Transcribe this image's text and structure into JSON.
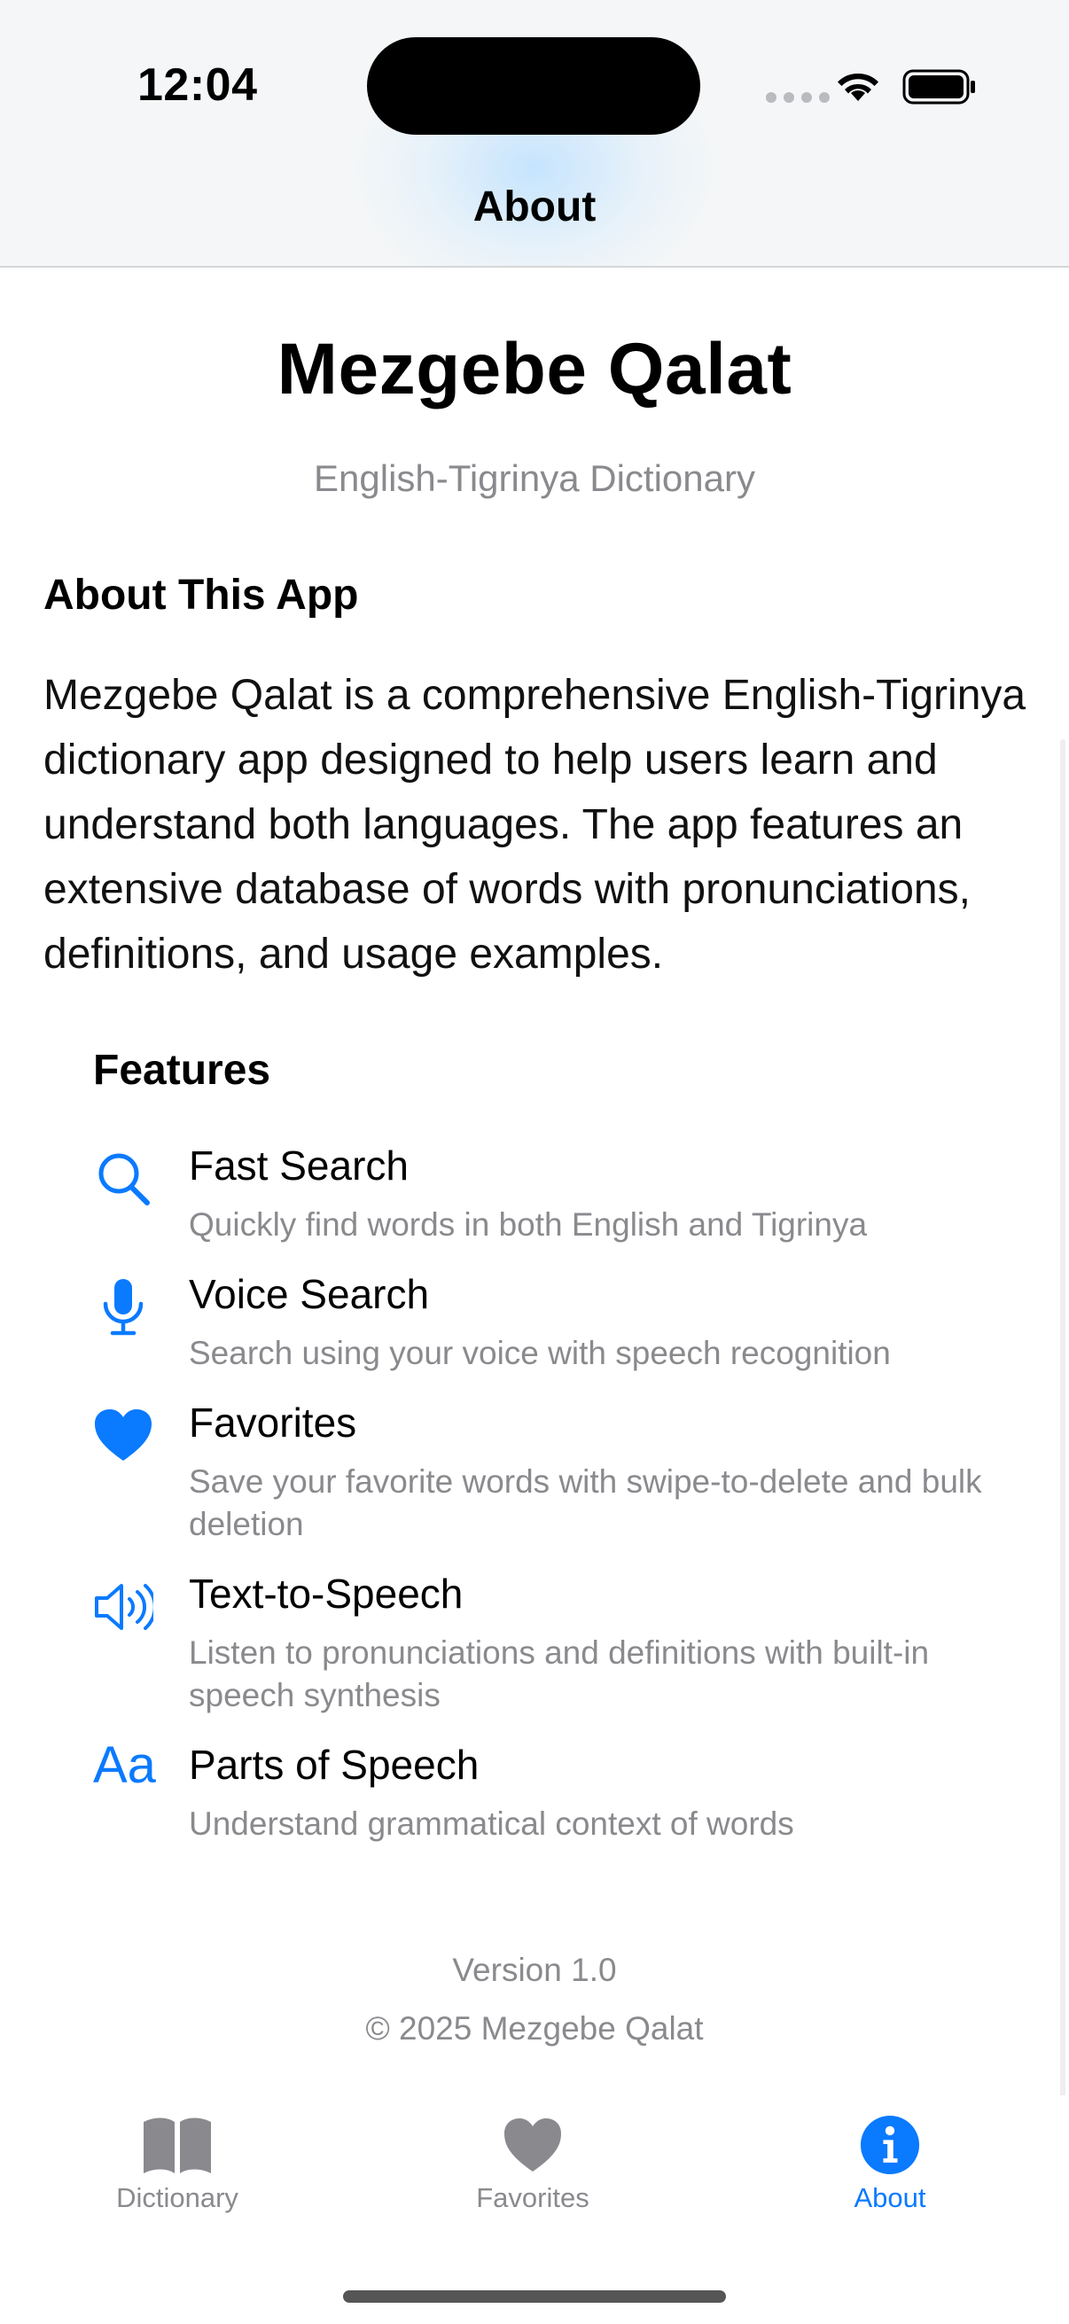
{
  "status_bar": {
    "time": "12:04"
  },
  "nav": {
    "title": "About"
  },
  "header": {
    "app_title": "Mezgebe Qalat",
    "subtitle": "English-Tigrinya Dictionary"
  },
  "about": {
    "heading": "About This App",
    "body": "Mezgebe Qalat is a comprehensive English-Tigrinya dictionary app designed to help users learn and understand both languages. The app features an extensive database of words with pronunciations, definitions, and usage examples."
  },
  "features": {
    "heading": "Features",
    "items": [
      {
        "icon": "magnifying-glass-icon",
        "title": "Fast Search",
        "description": "Quickly find words in both English and Tigrinya"
      },
      {
        "icon": "microphone-icon",
        "title": "Voice Search",
        "description": "Search using your voice with speech recognition"
      },
      {
        "icon": "heart-icon",
        "title": "Favorites",
        "description": "Save your favorite words with swipe-to-delete and bulk deletion"
      },
      {
        "icon": "speaker-wave-icon",
        "title": "Text-to-Speech",
        "description": "Listen to pronunciations and definitions with built-in speech synthesis"
      },
      {
        "icon": "text-format-icon",
        "title": "Parts of Speech",
        "description": "Understand grammatical context of words",
        "icon_text": "Aa"
      }
    ]
  },
  "footer": {
    "version": "Version 1.0",
    "copyright": "© 2025 Mezgebe Qalat"
  },
  "tab_bar": {
    "tabs": [
      {
        "label": "Dictionary",
        "icon": "book-icon",
        "active": false
      },
      {
        "label": "Favorites",
        "icon": "heart-icon",
        "active": false
      },
      {
        "label": "About",
        "icon": "info-circle-icon",
        "active": true
      }
    ]
  },
  "colors": {
    "accent": "#0a7aff",
    "secondary_text": "#8a8a8e",
    "inactive_tab": "#8a8a8e"
  }
}
